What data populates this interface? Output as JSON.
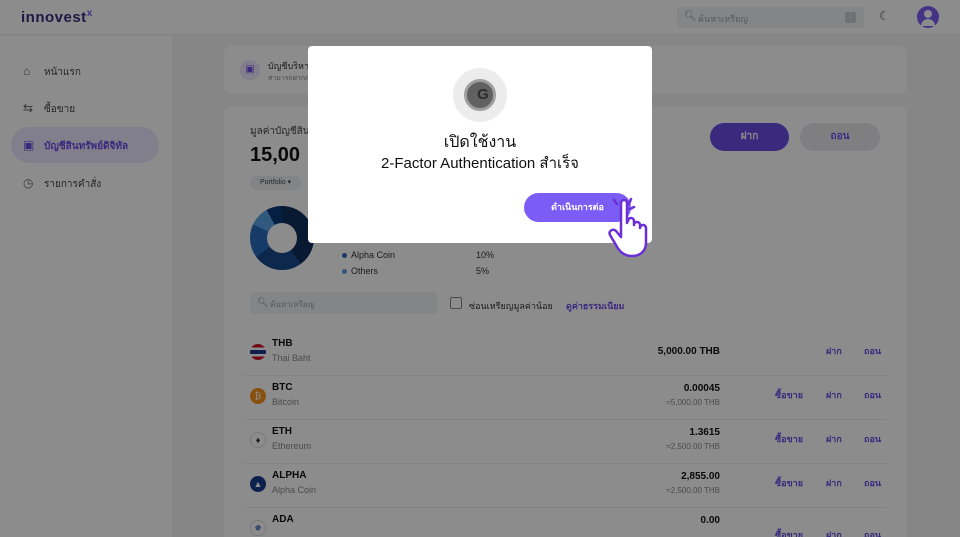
{
  "header": {
    "logo": "innovest",
    "logo_sup": "x",
    "search_placeholder": "ค้นหาเหรียญ",
    "kbd_hint": "/"
  },
  "sidebar": {
    "items": [
      {
        "label": "หน้าแรก",
        "icon": "home-icon"
      },
      {
        "label": "ซื้อขาย",
        "icon": "swap-icon"
      },
      {
        "label": "บัญชีสินทรัพย์ดิจิทัล",
        "icon": "wallet-icon",
        "active": true
      },
      {
        "label": "รายการคำสั่ง",
        "icon": "clock-icon"
      }
    ]
  },
  "banner": {
    "title": "บัญชีบริหา",
    "subtitle": "สามารถฝากถอ"
  },
  "portfolio": {
    "value_label": "มูลค่าบัญชีสิน",
    "value": "15,00",
    "chip": "Portfolio ▾",
    "deposit_label": "ฝาก",
    "withdraw_label": "ถอน",
    "legend": [
      {
        "name": "Alpha Coin",
        "pct": "10%",
        "color": "#2a6cbf"
      },
      {
        "name": "Others",
        "pct": "5%",
        "color": "#5aa3e5"
      }
    ]
  },
  "filters": {
    "search_placeholder": "ค้นหาเหรียญ",
    "hide_small_label": "ซ่อนเหรียญมูลค่าน้อย",
    "fee_link": "ดูค่าธรรมเนียม"
  },
  "assets": [
    {
      "symbol": "THB",
      "name": "Thai Baht",
      "amount": "5,000.00 THB",
      "sub": "",
      "trade": "",
      "deposit": "ฝาก",
      "withdraw": "ถอน",
      "icon_color": "#c8102e"
    },
    {
      "symbol": "BTC",
      "name": "Bitcoin",
      "amount": "0.00045",
      "sub": "≈5,000.00 THB",
      "trade": "ซื้อขาย",
      "deposit": "ฝาก",
      "withdraw": "ถอน",
      "icon_color": "#f7931a"
    },
    {
      "symbol": "ETH",
      "name": "Ethereum",
      "amount": "1.3615",
      "sub": "≈2,500.00 THB",
      "trade": "ซื้อขาย",
      "deposit": "ฝาก",
      "withdraw": "ถอน",
      "icon_color": "#ffffff"
    },
    {
      "symbol": "ALPHA",
      "name": "Alpha Coin",
      "amount": "2,855.00",
      "sub": "≈2,500.00 THB",
      "trade": "ซื้อขาย",
      "deposit": "ฝาก",
      "withdraw": "ถอน",
      "icon_color": "#173e8c"
    },
    {
      "symbol": "ADA",
      "name": "",
      "amount": "0.00",
      "sub": "",
      "trade": "ซื้อขาย",
      "deposit": "ฝาก",
      "withdraw": "ถอน",
      "icon_color": "#0033ad"
    }
  ],
  "modal": {
    "title_line1": "เปิดใช้งาน",
    "title_line2": "2-Factor Authentication สำเร็จ",
    "continue_label": "ดำเนินการต่อ",
    "icon": "google-authenticator-icon",
    "icon_glyph": "G"
  }
}
